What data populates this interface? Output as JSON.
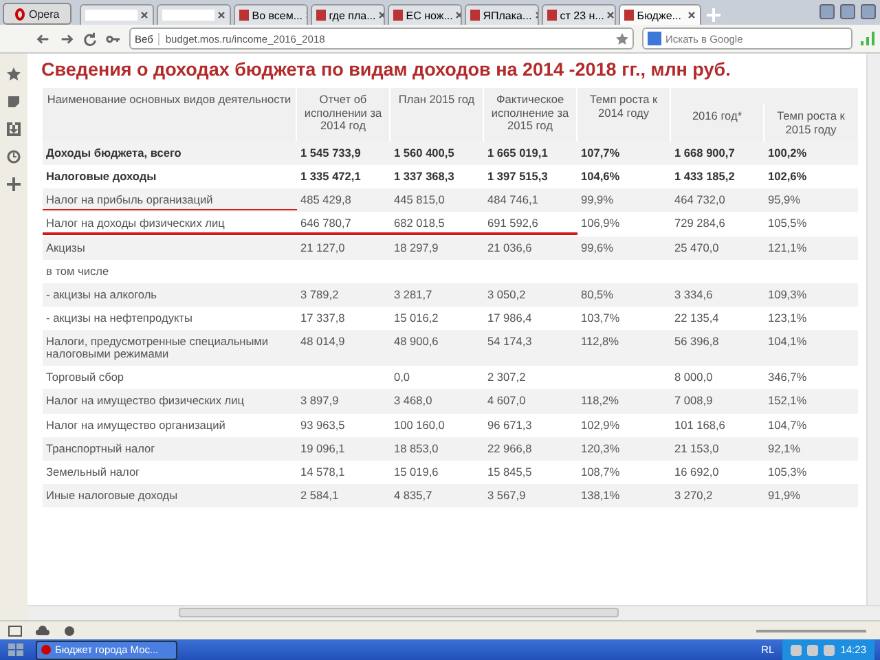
{
  "browser": {
    "menu_button": "Opera",
    "tabs": [
      {
        "selected": false
      },
      {
        "selected": false
      },
      {
        "title": "Во всем...",
        "selected": false
      },
      {
        "title": "где пла...",
        "selected": false
      },
      {
        "title": "ЕС нож...",
        "selected": false
      },
      {
        "title": "ЯПлака...",
        "selected": false
      },
      {
        "title": "ст 23 н...",
        "selected": false
      },
      {
        "title": "Бюдже...",
        "selected": true
      }
    ],
    "address": {
      "badge": "Веб",
      "url": "budget.mos.ru/income_2016_2018"
    },
    "search": {
      "placeholder": "Искать в Google"
    }
  },
  "page": {
    "title": "Сведения о доходах бюджета по видам доходов на 2014 -2018 гг., млн руб.",
    "table": {
      "columns": [
        "Наименование основных видов деятельности",
        "Отчет об исполнении за 2014 год",
        "План 2015 год",
        "Фактическое исполнение за 2015 год",
        "Темп роста к 2014 году",
        "2016 год*",
        "Темп роста к 2015 году"
      ],
      "rows": [
        {
          "bold": true,
          "underlined": false,
          "cells": [
            "Доходы бюджета, всего",
            "1 545 733,9",
            "1 560 400,5",
            "1 665 019,1",
            "107,7%",
            "1 668 900,7",
            "100,2%"
          ]
        },
        {
          "bold": true,
          "underlined": false,
          "cells": [
            "Налоговые доходы",
            "1 335 472,1",
            "1 337 368,3",
            "1 397 515,3",
            "104,6%",
            "1 433 185,2",
            "102,6%"
          ]
        },
        {
          "bold": false,
          "underlined": true,
          "cells": [
            "Налог на прибыль организаций",
            "485 429,8",
            "445 815,0",
            "484 746,1",
            "99,9%",
            "464 732,0",
            "95,9%"
          ]
        },
        {
          "bold": false,
          "underlined": true,
          "cells": [
            "Налог на доходы физических лиц",
            "646 780,7",
            "682 018,5",
            "691 592,6",
            "106,9%",
            "729 284,6",
            "105,5%"
          ]
        },
        {
          "bold": false,
          "underlined": false,
          "cells": [
            "Акцизы",
            "21 127,0",
            "18 297,9",
            "21 036,6",
            "99,6%",
            "25 470,0",
            "121,1%"
          ]
        },
        {
          "bold": false,
          "underlined": false,
          "cells": [
            "в том числе",
            "",
            "",
            "",
            "",
            "",
            ""
          ]
        },
        {
          "bold": false,
          "underlined": false,
          "cells": [
            "- акцизы на алкоголь",
            "3 789,2",
            "3 281,7",
            "3 050,2",
            "80,5%",
            "3 334,6",
            "109,3%"
          ]
        },
        {
          "bold": false,
          "underlined": false,
          "cells": [
            "- акцизы на нефтепродукты",
            "17 337,8",
            "15 016,2",
            "17 986,4",
            "103,7%",
            "22 135,4",
            "123,1%"
          ]
        },
        {
          "bold": false,
          "underlined": false,
          "cells": [
            "Налоги, предусмотренные специальными налоговыми режимами",
            "48 014,9",
            "48 900,6",
            "54 174,3",
            "112,8%",
            "56 396,8",
            "104,1%"
          ]
        },
        {
          "bold": false,
          "underlined": false,
          "cells": [
            "Торговый сбор",
            "",
            "0,0",
            "2 307,2",
            "",
            "8 000,0",
            "346,7%"
          ]
        },
        {
          "bold": false,
          "underlined": false,
          "cells": [
            "Налог на имущество физических лиц",
            "3 897,9",
            "3 468,0",
            "4 607,0",
            "118,2%",
            "7 008,9",
            "152,1%"
          ]
        },
        {
          "bold": false,
          "underlined": false,
          "cells": [
            "Налог на имущество организаций",
            "93 963,5",
            "100 160,0",
            "96 671,3",
            "102,9%",
            "101 168,6",
            "104,7%"
          ]
        },
        {
          "bold": false,
          "underlined": false,
          "cells": [
            "Транспортный налог",
            "19 096,1",
            "18 853,0",
            "22 966,8",
            "120,3%",
            "21 153,0",
            "92,1%"
          ]
        },
        {
          "bold": false,
          "underlined": false,
          "cells": [
            "Земельный налог",
            "14 578,1",
            "15 019,6",
            "15 845,5",
            "108,7%",
            "16 692,0",
            "105,3%"
          ]
        },
        {
          "bold": false,
          "underlined": false,
          "cells": [
            "Иные налоговые доходы",
            "2 584,1",
            "4 835,7",
            "3 567,9",
            "138,1%",
            "3 270,2",
            "91,9%"
          ]
        }
      ]
    }
  },
  "taskbar": {
    "task": "Бюджет города Мос...",
    "language": "RL",
    "clock": "14:23"
  }
}
